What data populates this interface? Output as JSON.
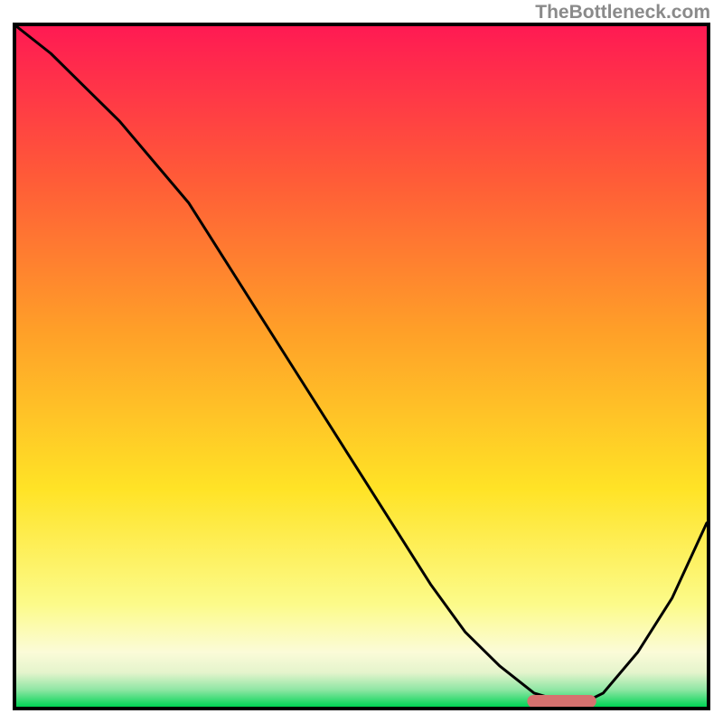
{
  "chart_data": {
    "type": "line",
    "title": "",
    "xlabel": "",
    "ylabel": "",
    "xlim": [
      0,
      100
    ],
    "ylim": [
      0,
      100
    ],
    "x": [
      0,
      5,
      10,
      15,
      20,
      25,
      30,
      35,
      40,
      45,
      50,
      55,
      60,
      65,
      70,
      75,
      80,
      82,
      85,
      90,
      95,
      100
    ],
    "values": [
      100,
      96,
      91,
      86,
      80,
      74,
      66,
      58,
      50,
      42,
      34,
      26,
      18,
      11,
      6,
      2,
      0.5,
      0.5,
      2,
      8,
      16,
      27
    ],
    "annotations": {
      "marker_segment": {
        "x0": 74,
        "x1": 84,
        "y": 0.8,
        "color": "#d6716f"
      },
      "green_band": {
        "y0": 0,
        "y1": 2.5,
        "color_top": "#b7e8c0",
        "color_bottom": "#00d455"
      },
      "yellow_band": {
        "y0": 2.5,
        "y1": 11,
        "color_top": "#fffdd8",
        "color_bottom": "#fbf9b8"
      }
    }
  },
  "gradient": {
    "top": "#ff1a53",
    "mid1": "#ff7a2a",
    "mid2": "#ffd524",
    "low": "#fdfcc0",
    "band": "#d6f1c0",
    "green": "#00d455"
  },
  "watermark": "TheBottleneck.com"
}
